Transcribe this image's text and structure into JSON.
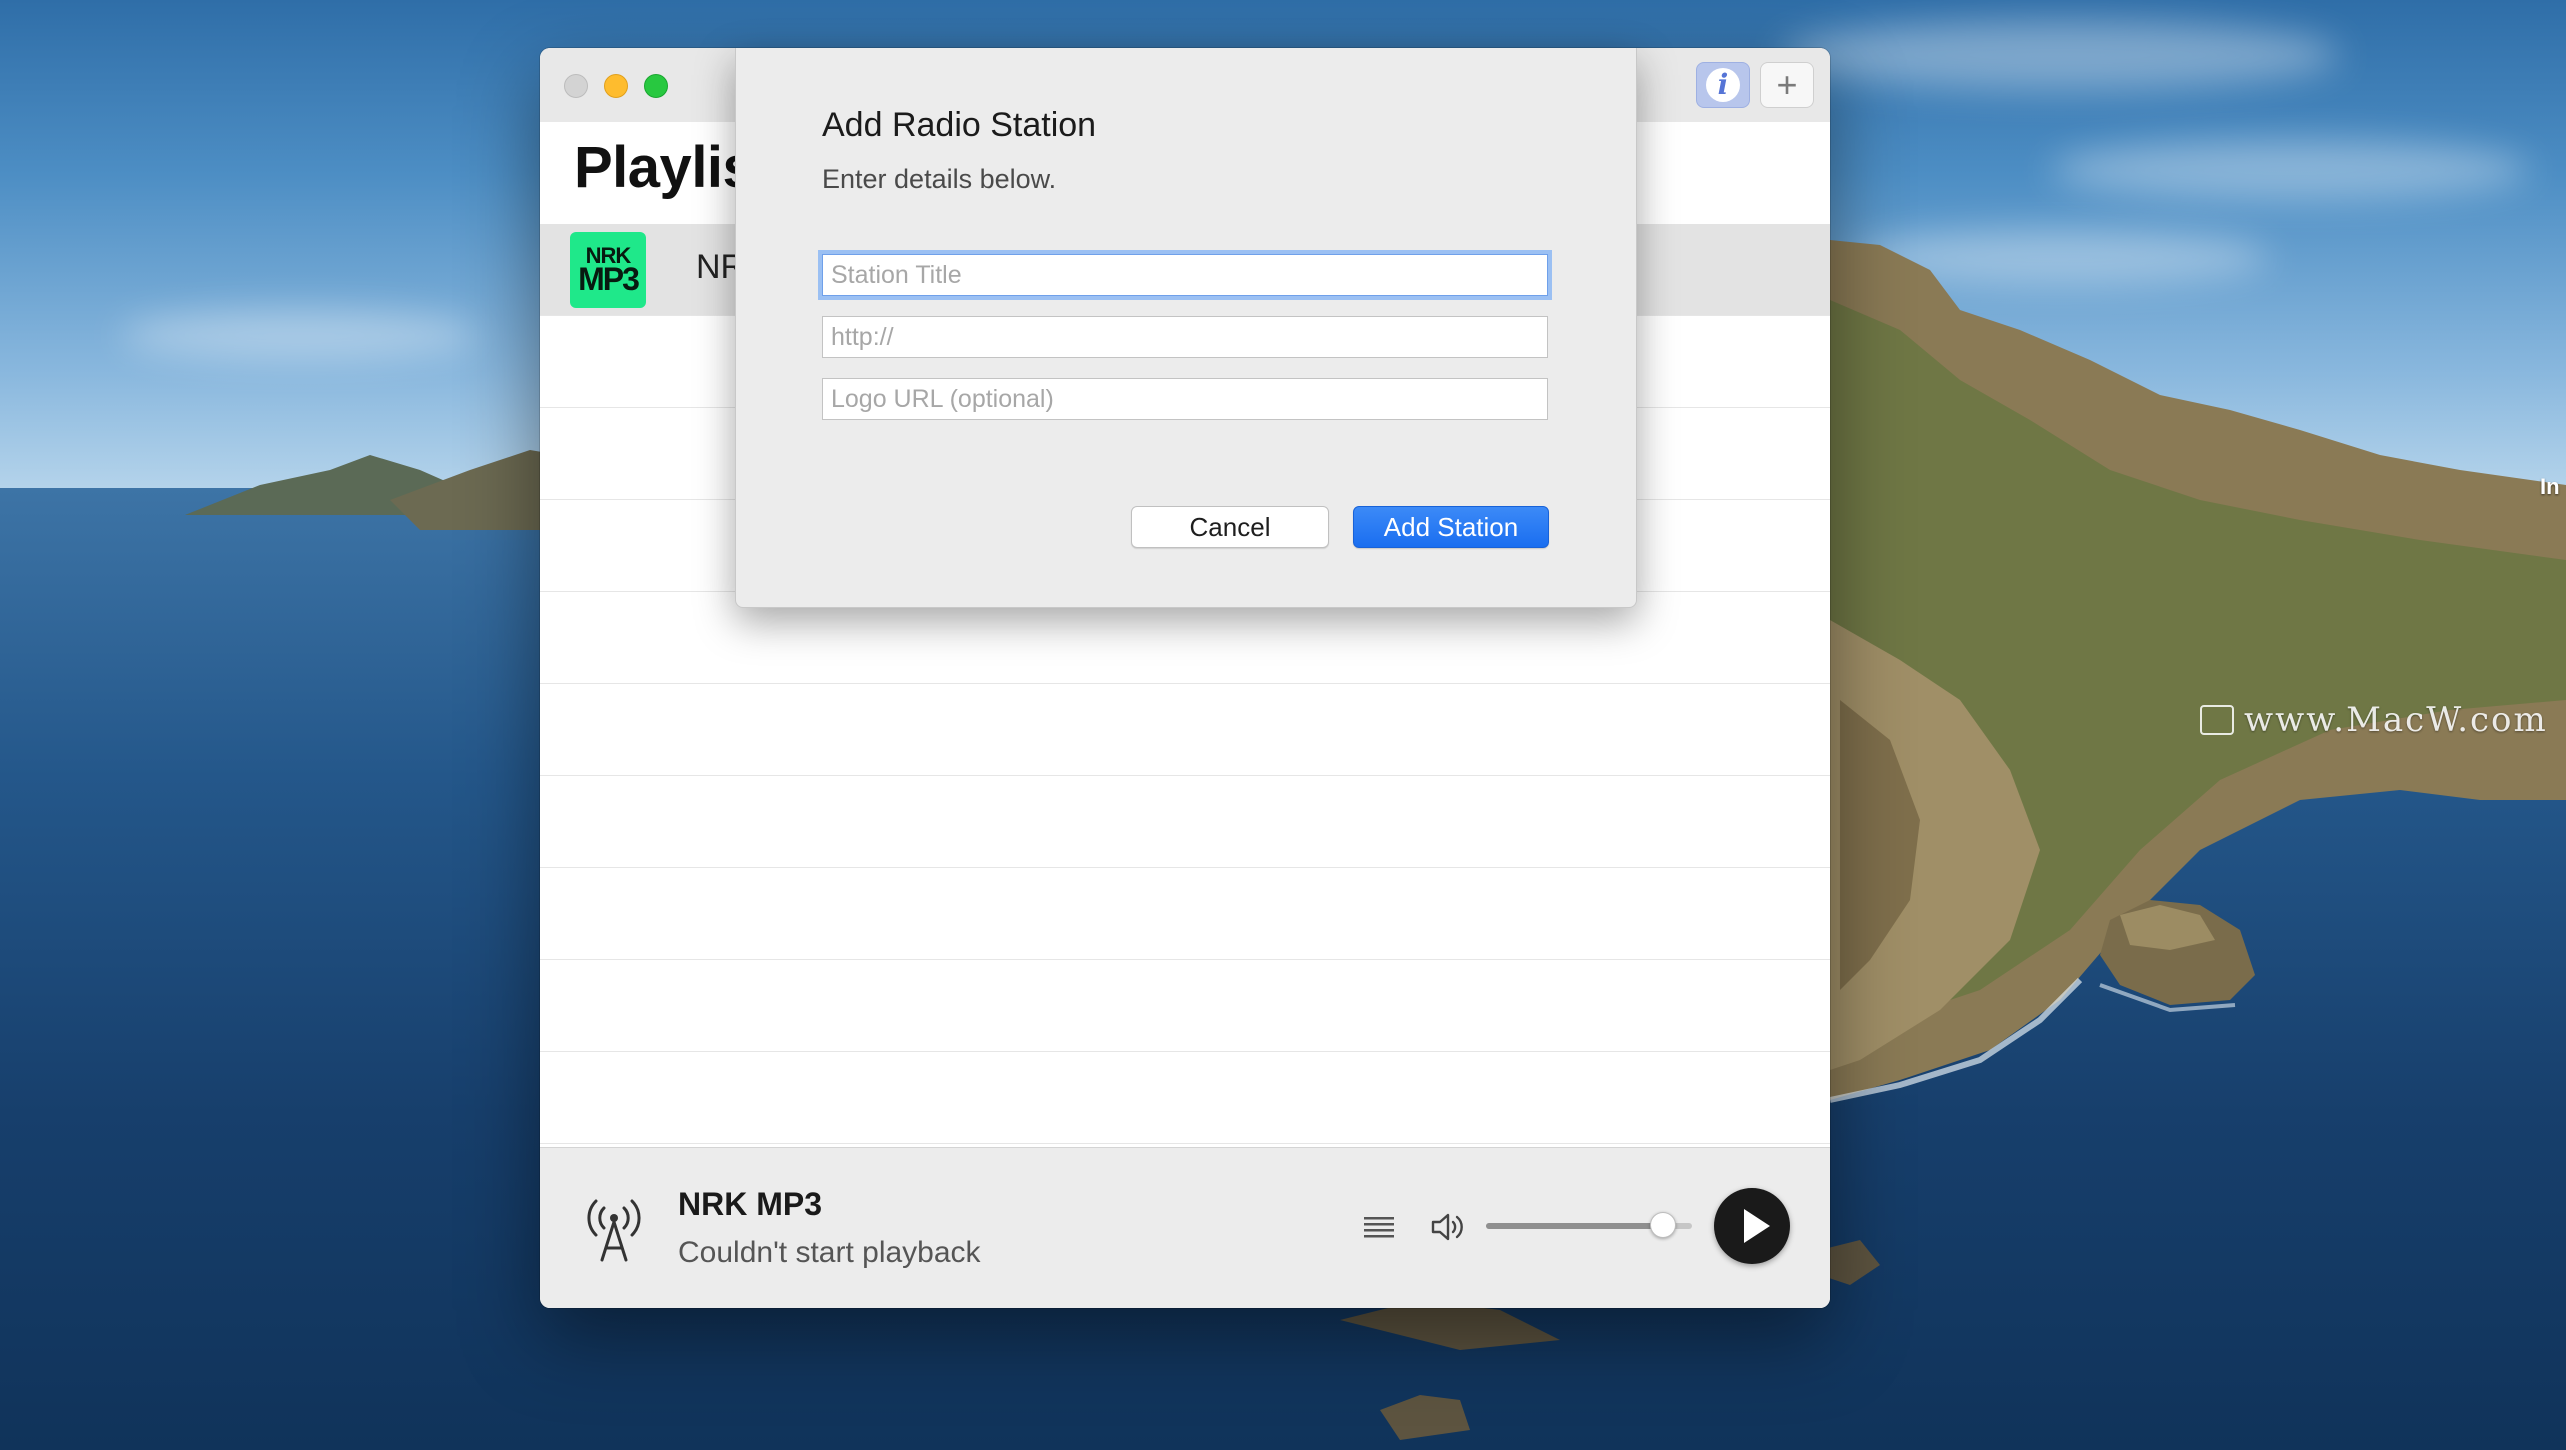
{
  "desktop": {
    "watermark": "www.MacW.com",
    "edge_label": "In"
  },
  "window": {
    "page_title": "Playlis",
    "playlist": [
      {
        "logo_top": "NRK",
        "logo_bottom": "MP3",
        "title": "NR"
      }
    ]
  },
  "player": {
    "station": "NRK MP3",
    "status": "Couldn't start playback",
    "volume_fraction": 0.86
  },
  "dialog": {
    "title": "Add Radio Station",
    "subtitle": "Enter details below.",
    "fields": {
      "station_title_placeholder": "Station Title",
      "station_title_value": "",
      "url_placeholder": "http://",
      "url_value": "",
      "logo_placeholder": "Logo URL (optional)",
      "logo_value": ""
    },
    "cancel_label": "Cancel",
    "add_label": "Add Station"
  },
  "colors": {
    "accent": "#1a6ef0",
    "nrk_green": "#1fe88a",
    "info_tint": "#5574d6"
  },
  "icons": {
    "info": "info-icon",
    "add": "plus-icon",
    "antenna": "antenna-icon",
    "list": "list-icon",
    "volume": "speaker-icon",
    "play": "play-icon"
  }
}
